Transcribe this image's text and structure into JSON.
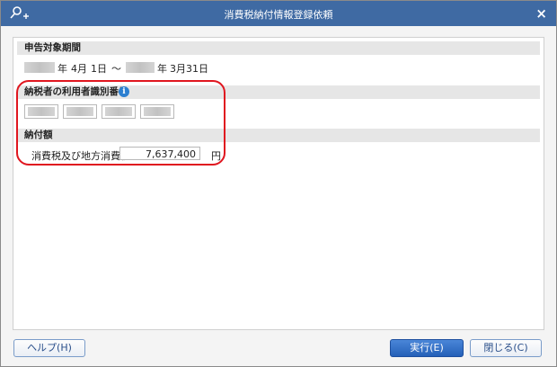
{
  "window": {
    "title": "消費税納付情報登録依頼",
    "close_symbol": "×"
  },
  "period": {
    "header": "申告対象期間",
    "start_year_suffix": "年",
    "start_month": "4月",
    "start_day": "1日",
    "separator": "～",
    "end_year_suffix": "年",
    "end_date": "3月31日"
  },
  "taxpayer_id": {
    "header": "納税者の利用者識別番号",
    "info_symbol": "i"
  },
  "payment": {
    "header": "納付額",
    "label": "消費税及び地方消費税",
    "value": "7,637,400",
    "unit": "円"
  },
  "buttons": {
    "help": "ヘルプ(H)",
    "execute": "実行(E)",
    "close": "閉じる(C)"
  },
  "colors": {
    "titlebar": "#3f6aa3",
    "highlight": "#e0161f",
    "primary_button": "#2460b8"
  },
  "icons": {
    "title_icon": "key-add-icon",
    "info_icon": "info-icon",
    "close_icon": "close-icon"
  }
}
